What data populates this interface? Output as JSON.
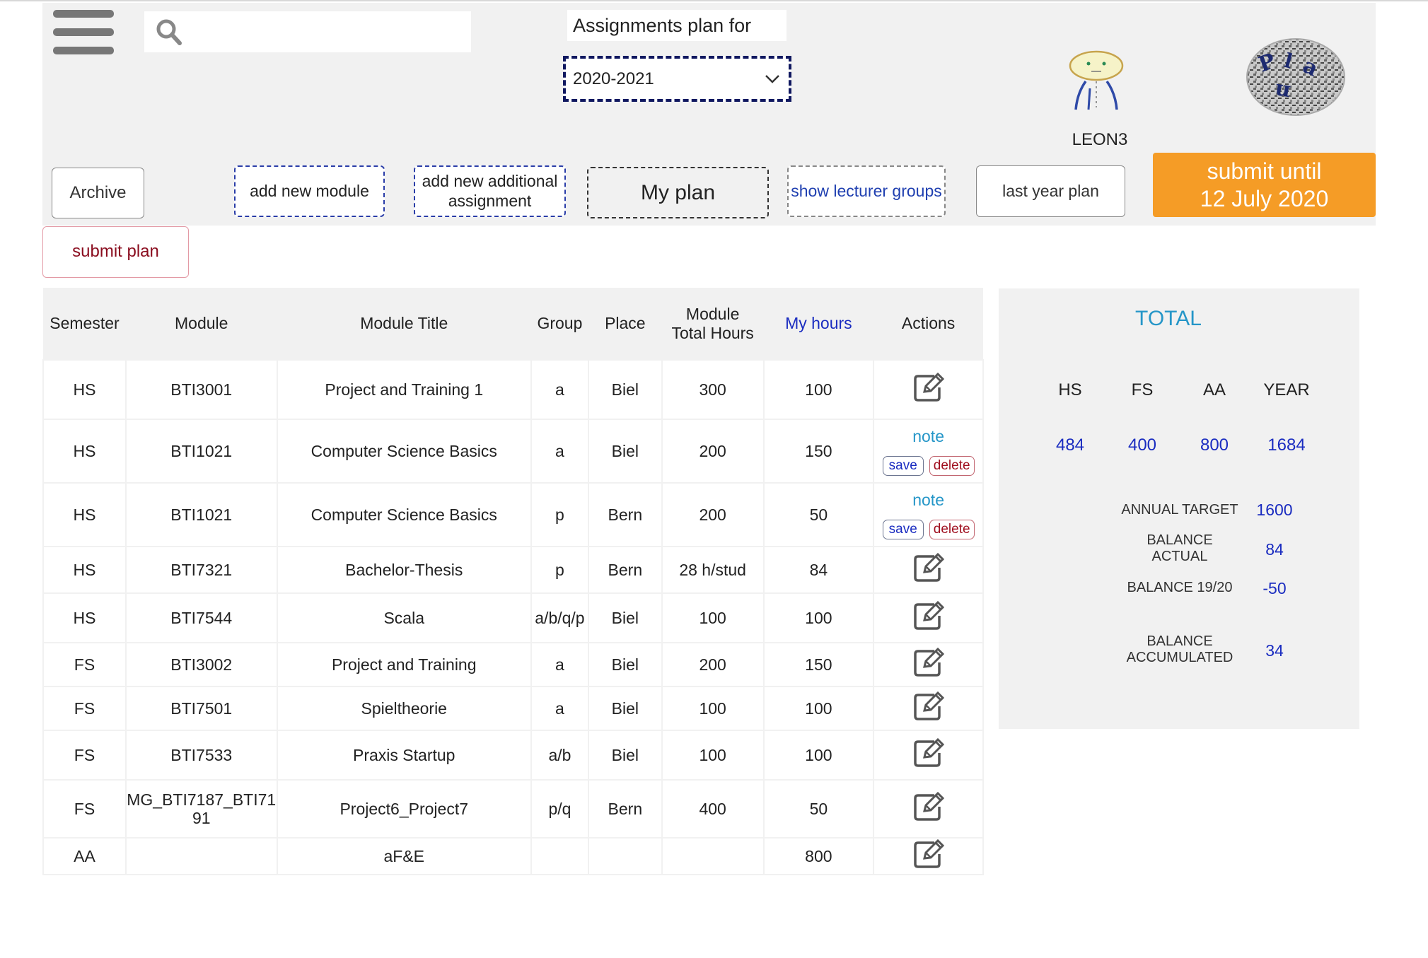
{
  "header": {
    "search_placeholder": "",
    "plan_label": "Assignments plan for",
    "year_selected": "2020-2021",
    "username": "LEON3",
    "colors": {
      "accent_orange": "#f59c26",
      "link_blue": "#1a2cc0",
      "total_blue": "#2596c8"
    }
  },
  "buttons": {
    "archive": "Archive",
    "add_module": "add new module",
    "add_additional": "add new additional assignment",
    "my_plan": "My plan",
    "show_lecturer_groups": "show lecturer groups",
    "last_year_plan": "last year plan",
    "submit_until_line1": "submit until",
    "submit_until_line2": "12 July 2020",
    "submit_plan": "submit plan"
  },
  "table": {
    "headers": {
      "semester": "Semester",
      "module": "Module",
      "title": "Module Title",
      "group": "Group",
      "place": "Place",
      "total_line1": "Module",
      "total_line2": "Total Hours",
      "my_hours": "My hours",
      "actions": "Actions"
    },
    "actions": {
      "note": "note",
      "save": "save",
      "delete": "delete"
    },
    "rows": [
      {
        "semester": "HS",
        "module": "BTI3001",
        "title": "Project and Training 1",
        "group": "a",
        "place": "Biel",
        "total": "300",
        "hours": "100",
        "action": "edit-icon"
      },
      {
        "semester": "HS",
        "module": "BTI1021",
        "title": "Computer Science Basics",
        "group": "a",
        "place": "Biel",
        "total": "200",
        "hours": "150",
        "action": "note-save-delete"
      },
      {
        "semester": "HS",
        "module": "BTI1021",
        "title": "Computer Science Basics",
        "group": "p",
        "place": "Bern",
        "total": "200",
        "hours": "50",
        "action": "note-save-delete"
      },
      {
        "semester": "HS",
        "module": "BTI7321",
        "title": "Bachelor-Thesis",
        "group": "p",
        "place": "Bern",
        "total": "28 h/stud",
        "hours": "84",
        "action": "edit-icon"
      },
      {
        "semester": "HS",
        "module": "BTI7544",
        "title": "Scala",
        "group": "a/b/q/p",
        "place": "Biel",
        "total": "100",
        "hours": "100",
        "action": "edit-icon"
      },
      {
        "semester": "FS",
        "module": "BTI3002",
        "title": "Project and Training",
        "group": "a",
        "place": "Biel",
        "total": "200",
        "hours": "150",
        "action": "edit-icon"
      },
      {
        "semester": "FS",
        "module": "BTI7501",
        "title": "Spieltheorie",
        "group": "a",
        "place": "Biel",
        "total": "100",
        "hours": "100",
        "action": "edit-icon"
      },
      {
        "semester": "FS",
        "module": "BTI7533",
        "title": "Praxis Startup",
        "group": "a/b",
        "place": "Biel",
        "total": "100",
        "hours": "100",
        "action": "edit-icon"
      },
      {
        "semester": "FS",
        "module": "MG_BTI7187_BTI7191",
        "title": "Project6_Project7",
        "group": "p/q",
        "place": "Bern",
        "total": "400",
        "hours": "50",
        "action": "edit-icon"
      },
      {
        "semester": "AA",
        "module": "",
        "title": "aF&E",
        "group": "",
        "place": "",
        "total": "",
        "hours": "800",
        "action": "edit-icon"
      }
    ]
  },
  "totals": {
    "title": "TOTAL",
    "headers": {
      "hs": "HS",
      "fs": "FS",
      "aa": "AA",
      "year": "YEAR"
    },
    "values": {
      "hs": "484",
      "fs": "400",
      "aa": "800",
      "year": "1684"
    },
    "annual_target_label": "ANNUAL TARGET",
    "annual_target": "1600",
    "balance_actual_label": "BALANCE ACTUAL",
    "balance_actual": "84",
    "balance_prev_label": "BALANCE 19/20",
    "balance_prev": "-50",
    "balance_accumulated_label": "BALANCE ACCUMULATED",
    "balance_accumulated": "34"
  }
}
